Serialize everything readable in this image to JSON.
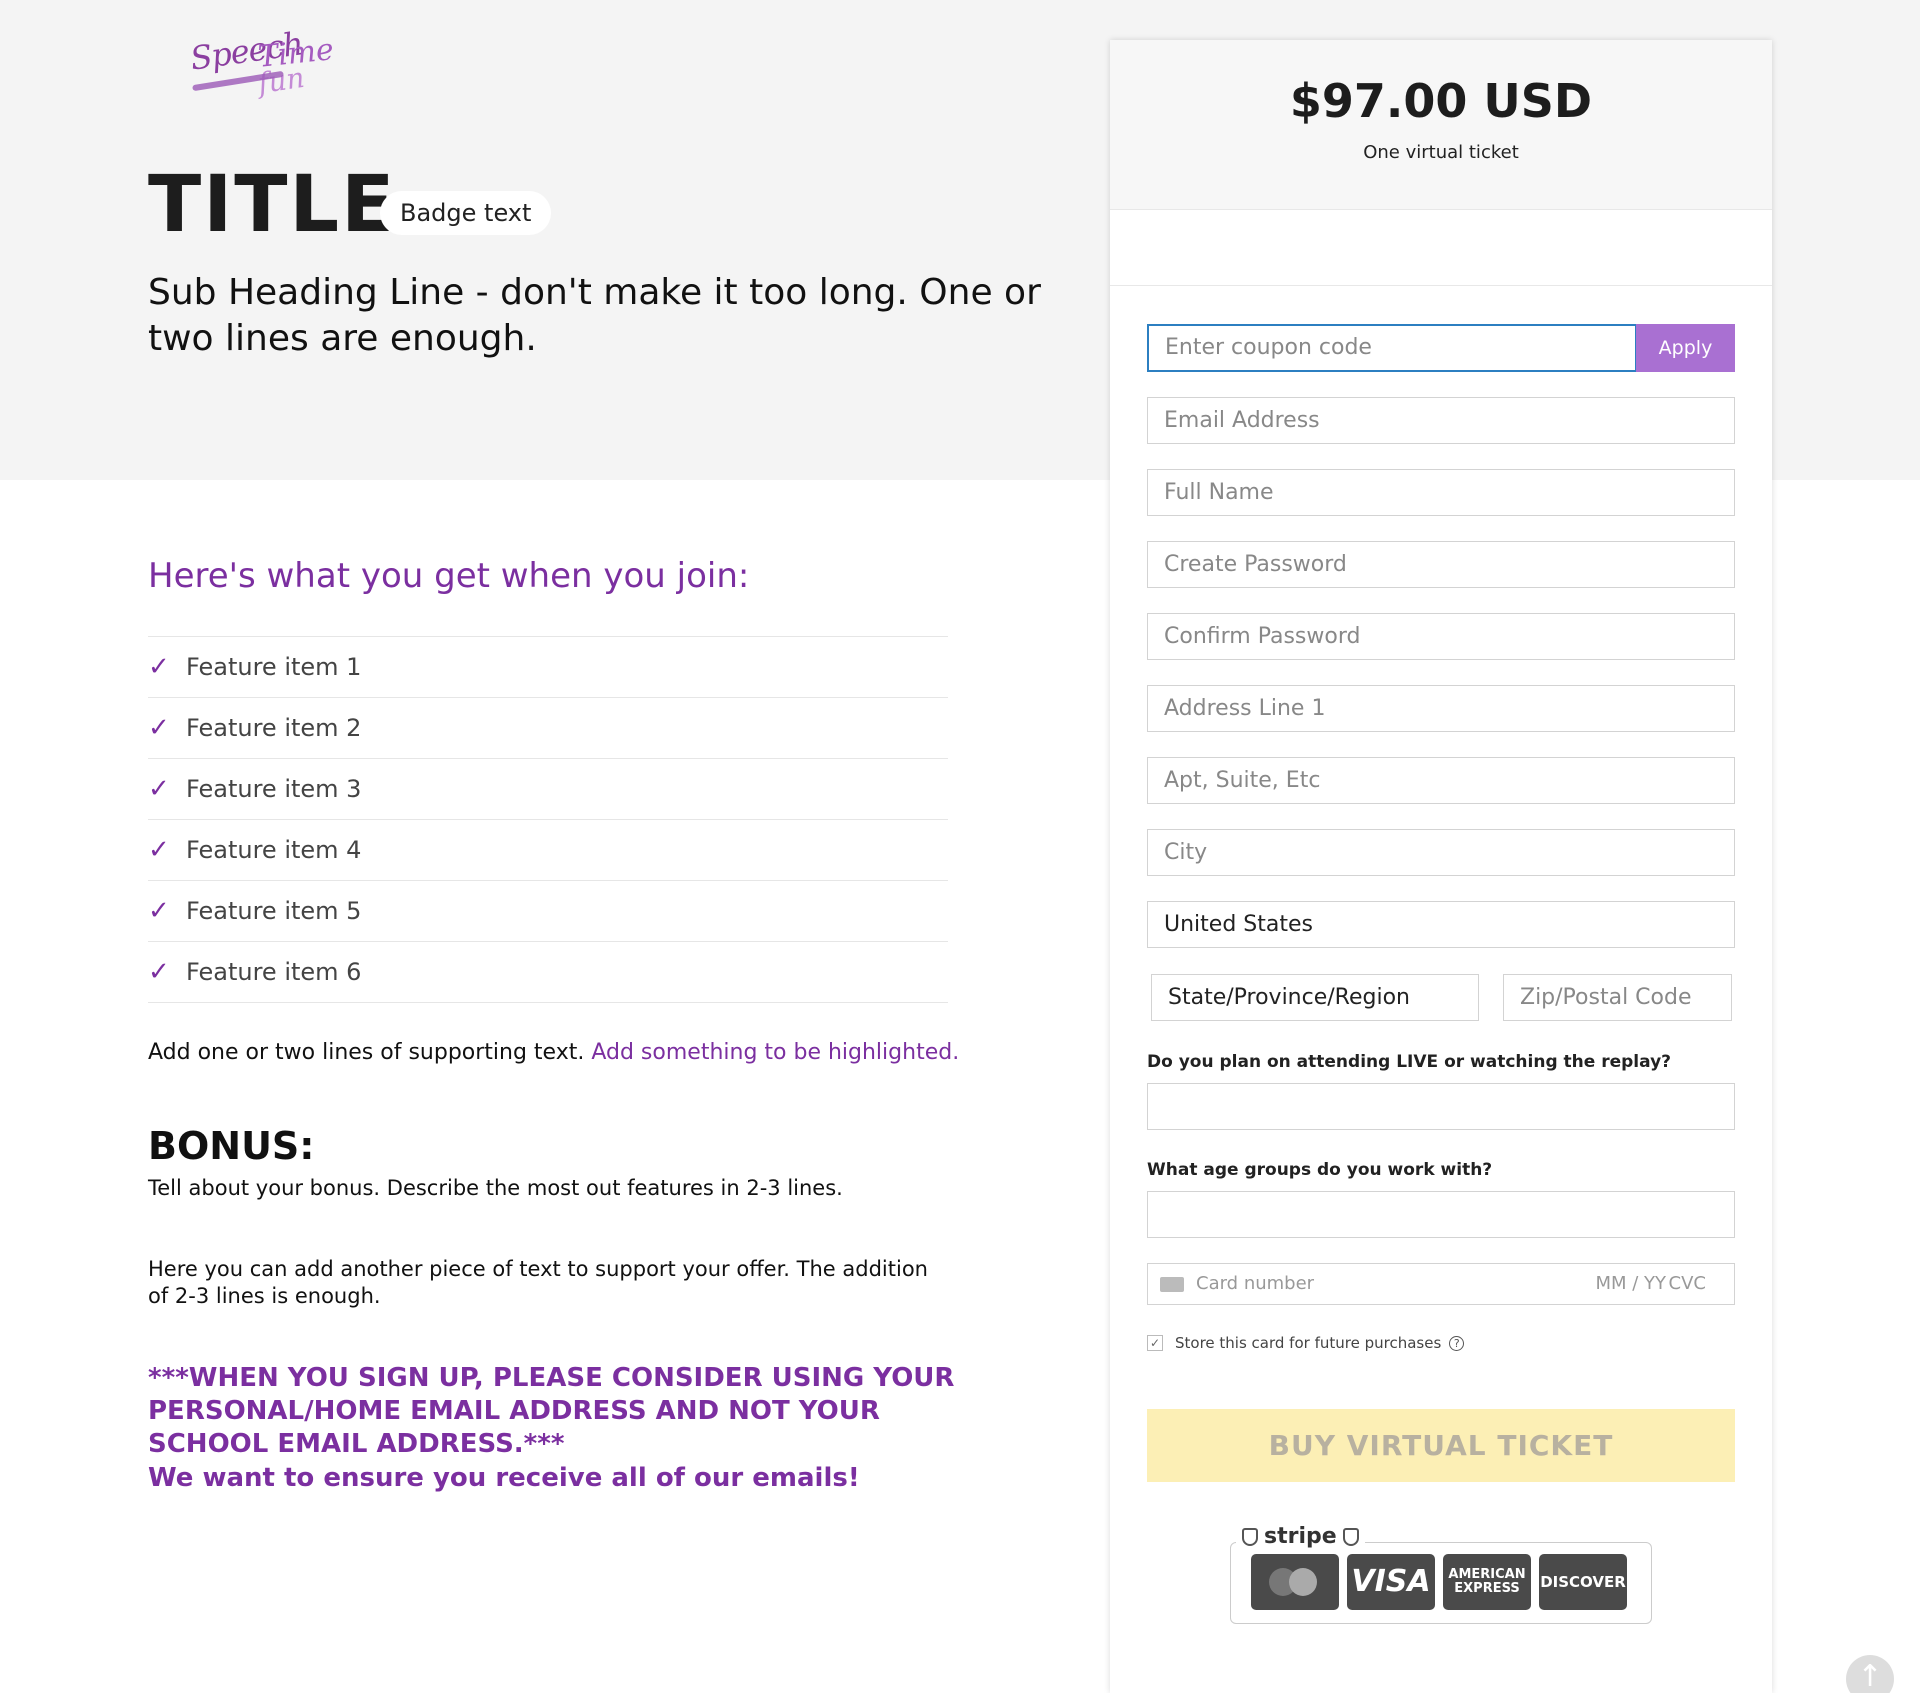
{
  "logo": {
    "word1": "Speech",
    "word2": "Time",
    "word3": "fun"
  },
  "hero": {
    "title": "TITLE",
    "badge": "Badge text",
    "subheading": "Sub Heading Line - don't make it too long. One or two lines are enough."
  },
  "features_section": {
    "heading": "Here's what you get when you join:",
    "check_icon": "✓",
    "items": [
      "Feature item 1",
      "Feature item 2",
      "Feature item 3",
      "Feature item 4",
      "Feature item 5",
      "Feature item 6"
    ]
  },
  "support": {
    "text": "Add one or two lines of supporting text.",
    "highlight": "Add something to be highlighted."
  },
  "bonus": {
    "title": "BONUS:",
    "text": "Tell about your bonus. Describe the most out features in 2-3 lines.",
    "another": "Here you can add another piece of text to support your offer. The addition of 2-3 lines is enough."
  },
  "notice": {
    "text": "***WHEN YOU SIGN UP, PLEASE CONSIDER USING YOUR PERSONAL/HOME EMAIL ADDRESS AND NOT YOUR SCHOOL EMAIL ADDRESS.***",
    "text2": "We want to ensure you receive all of our emails!"
  },
  "checkout": {
    "price": "$97.00 USD",
    "price_sub": "One virtual ticket",
    "coupon_placeholder": "Enter coupon code",
    "apply_label": "Apply",
    "email_placeholder": "Email Address",
    "name_placeholder": "Full Name",
    "password_placeholder": "Create Password",
    "confirm_placeholder": "Confirm Password",
    "address1_placeholder": "Address Line 1",
    "address2_placeholder": "Apt, Suite, Etc",
    "city_placeholder": "City",
    "country_value": "United States",
    "state_value": "State/Province/Region",
    "zip_placeholder": "Zip/Postal Code",
    "question1": "Do you plan on attending LIVE or watching the replay?",
    "question2": "What age groups do you work with?",
    "card_placeholder": "Card number",
    "card_exp": "MM / YY",
    "card_cvc": "CVC",
    "store_label": "Store this card for future purchases",
    "store_checked": "✓",
    "help_icon": "?",
    "buy_label": "BUY VIRTUAL TICKET",
    "stripe_label": "stripe",
    "visa_label": "VISA",
    "amex_label1": "AMERICAN",
    "amex_label2": "EXPRESS",
    "discover_label": "DISCOVER"
  },
  "scroll_icon": "↑",
  "colors": {
    "accent": "#7b2fa0",
    "apply_button": "#a970d2",
    "buy_button": "#fcefb5",
    "focus_border": "#2c7fc1"
  }
}
